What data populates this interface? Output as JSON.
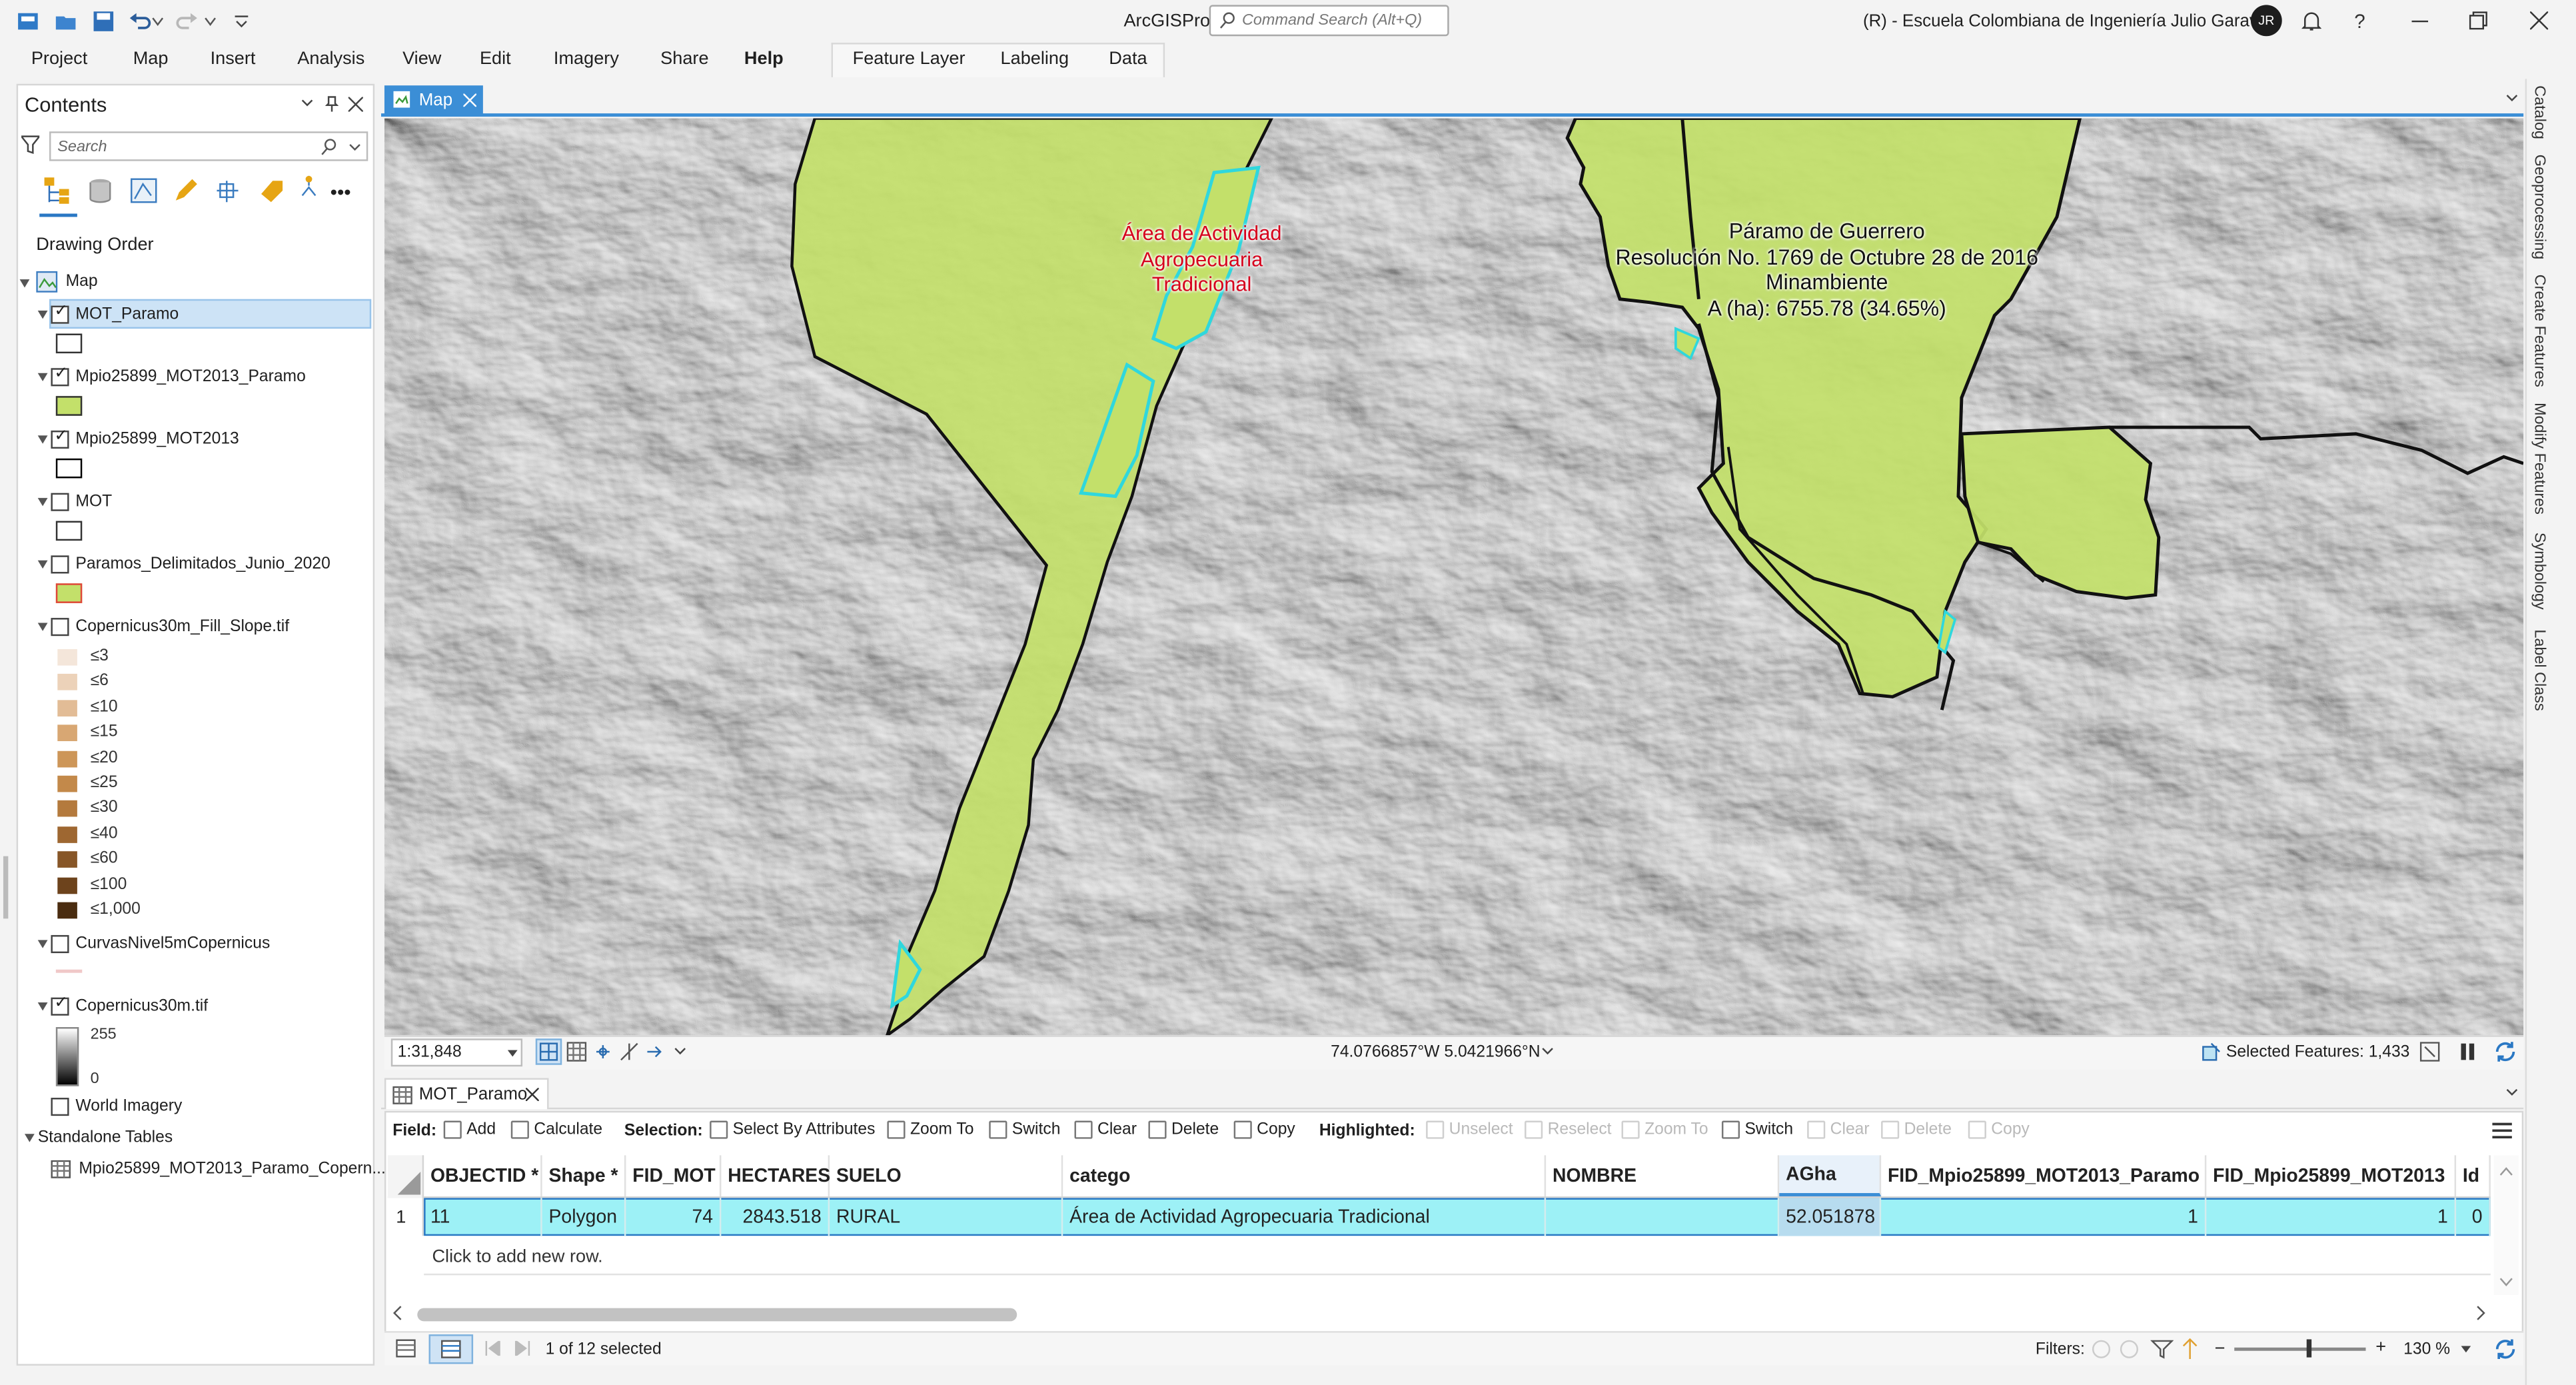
{
  "app": {
    "title": "ArcGISPro",
    "command_search_placeholder": "Command Search (Alt+Q)",
    "org_user": "(R) - Escuela Colombiana de Ingeniería Julio Garavito",
    "avatar_initials": "JR"
  },
  "ribbon": {
    "tabs": [
      "Project",
      "Map",
      "Insert",
      "Analysis",
      "View",
      "Edit",
      "Imagery",
      "Share",
      "Help"
    ],
    "active_tab": "Help",
    "contextual_tabs": [
      "Feature Layer",
      "Labeling",
      "Data"
    ]
  },
  "contents": {
    "title": "Contents",
    "search_placeholder": "Search",
    "section": "Drawing Order",
    "map_name": "Map",
    "layers": [
      {
        "name": "MOT_Paramo",
        "checked": true,
        "selected": true
      },
      {
        "name": "Mpio25899_MOT2013_Paramo",
        "checked": true
      },
      {
        "name": "Mpio25899_MOT2013",
        "checked": true
      },
      {
        "name": "MOT",
        "checked": false
      },
      {
        "name": "Paramos_Delimitados_Junio_2020",
        "checked": false
      },
      {
        "name": "Copernicus30m_Fill_Slope.tif",
        "checked": false
      },
      {
        "name": "CurvasNivel5mCopernicus",
        "checked": false
      },
      {
        "name": "Copernicus30m.tif",
        "checked": true
      },
      {
        "name": "World Imagery",
        "checked": false
      }
    ],
    "slope_legend": [
      {
        "label": "≤3",
        "color": "#f4e6da"
      },
      {
        "label": "≤6",
        "color": "#ecd2b9"
      },
      {
        "label": "≤10",
        "color": "#e2bc96"
      },
      {
        "label": "≤15",
        "color": "#d8a773"
      },
      {
        "label": "≤20",
        "color": "#cd9658"
      },
      {
        "label": "≤25",
        "color": "#c3894a"
      },
      {
        "label": "≤30",
        "color": "#b47a3d"
      },
      {
        "label": "≤40",
        "color": "#9e6731"
      },
      {
        "label": "≤60",
        "color": "#875627"
      },
      {
        "label": "≤100",
        "color": "#6d431c"
      },
      {
        "label": "≤1,000",
        "color": "#4a2c10"
      }
    ],
    "dem_legend": {
      "max": "255",
      "min": "0"
    },
    "standalone_tables_label": "Standalone Tables",
    "standalone_tables": [
      "Mpio25899_MOT2013_Paramo_Copern..."
    ]
  },
  "map_view": {
    "tab_label": "Map",
    "labels": {
      "aat": [
        "Área de Actividad",
        "Agropecuaria",
        "Tradicional"
      ],
      "paramo": [
        "Páramo de Guerrero",
        "Resolución No. 1769 de Octubre 28 de 2016",
        "Minambiente",
        "A (ha): 6755.78 (34.65%)"
      ]
    },
    "scale": "1:31,848",
    "coordinates": "74.0766857°W 5.0421966°N",
    "selected_features": "Selected Features: 1,433",
    "colors": {
      "polygon_fill": "#c3e06a",
      "selection_outline": "#2fd7dd",
      "label_red": "#d6001c"
    }
  },
  "side_tabs": [
    "Catalog",
    "Geoprocessing",
    "Create Features",
    "Modify Features",
    "Symbology",
    "Label Class"
  ],
  "table_view": {
    "tab_label": "MOT_Paramo",
    "field_label": "Field:",
    "field_buttons": [
      "Add",
      "Calculate"
    ],
    "selection_label": "Selection:",
    "selection_buttons": [
      "Select By Attributes",
      "Zoom To",
      "Switch",
      "Clear",
      "Delete",
      "Copy"
    ],
    "highlighted_label": "Highlighted:",
    "highlighted_buttons": [
      "Unselect",
      "Reselect",
      "Zoom To",
      "Switch",
      "Clear",
      "Delete",
      "Copy"
    ],
    "columns": [
      "OBJECTID *",
      "Shape *",
      "FID_MOT",
      "HECTARES",
      "SUELO",
      "catego",
      "NOMBRE",
      "AGha",
      "FID_Mpio25899_MOT2013_Paramo",
      "FID_Mpio25899_MOT2013",
      "Id"
    ],
    "rows": [
      {
        "rownum": "1",
        "cells": [
          "11",
          "Polygon",
          "74",
          "2843.518",
          "RURAL",
          "Área de Actividad Agropecuaria Tradicional",
          "",
          "52.051878",
          "1",
          "1",
          "0"
        ]
      }
    ],
    "add_row_text": "Click to add new row.",
    "selected_count": "1 of 12 selected",
    "filters_label": "Filters:",
    "zoom": "130 %"
  }
}
